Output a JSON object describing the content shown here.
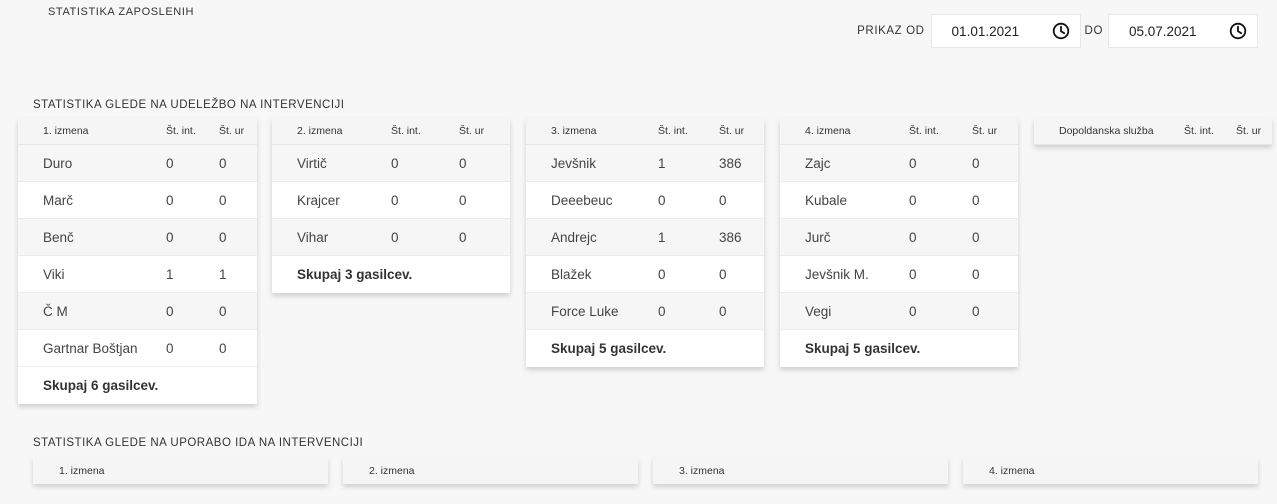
{
  "page_title": "STATISTIKA ZAPOSLENIH",
  "date_filter": {
    "from_label": "PRIKAZ OD",
    "from_value": "01.01.2021",
    "to_label": "DO",
    "to_value": "05.07.2021",
    "icon": "clock-icon"
  },
  "section_interventions": {
    "title": "STATISTIKA GLEDE NA UDELEŽBO NA INTERVENCIJI",
    "tables": [
      {
        "header": [
          "1. izmena",
          "Št. int.",
          "Št. ur"
        ],
        "rows": [
          [
            "Duro",
            "0",
            "0"
          ],
          [
            "Marč",
            "0",
            "0"
          ],
          [
            "Benč",
            "0",
            "0"
          ],
          [
            "Viki",
            "1",
            "1"
          ],
          [
            "Č M",
            "0",
            "0"
          ],
          [
            "Gartnar Boštjan",
            "0",
            "0"
          ]
        ],
        "footer": "Skupaj 6 gasilcev."
      },
      {
        "header": [
          "2. izmena",
          "Št. int.",
          "Št. ur"
        ],
        "rows": [
          [
            "Virtič",
            "0",
            "0"
          ],
          [
            "Krajcer",
            "0",
            "0"
          ],
          [
            "Vihar",
            "0",
            "0"
          ]
        ],
        "footer": "Skupaj 3 gasilcev."
      },
      {
        "header": [
          "3. izmena",
          "Št. int.",
          "Št. ur"
        ],
        "rows": [
          [
            "Jevšnik",
            "1",
            "386"
          ],
          [
            "Deeebeuc",
            "0",
            "0"
          ],
          [
            "Andrejc",
            "1",
            "386"
          ],
          [
            "Blažek",
            "0",
            "0"
          ],
          [
            "Force Luke",
            "0",
            "0"
          ]
        ],
        "footer": "Skupaj 5 gasilcev."
      },
      {
        "header": [
          "4. izmena",
          "Št. int.",
          "Št. ur"
        ],
        "rows": [
          [
            "Zajc",
            "0",
            "0"
          ],
          [
            "Kubale",
            "0",
            "0"
          ],
          [
            "Jurč",
            "0",
            "0"
          ],
          [
            "Jevšnik M.",
            "0",
            "0"
          ],
          [
            "Vegi",
            "0",
            "0"
          ]
        ],
        "footer": "Skupaj 5 gasilcev."
      },
      {
        "header": [
          "Dopoldanska služba",
          "Št. int.",
          "Št. ur"
        ],
        "rows": [],
        "footer": ""
      }
    ]
  },
  "section_ida": {
    "title": "STATISTIKA GLEDE NA UPORABO IDA NA INTERVENCIJI",
    "cards": [
      "1. izmena",
      "2. izmena",
      "3. izmena",
      "4. izmena"
    ]
  }
}
